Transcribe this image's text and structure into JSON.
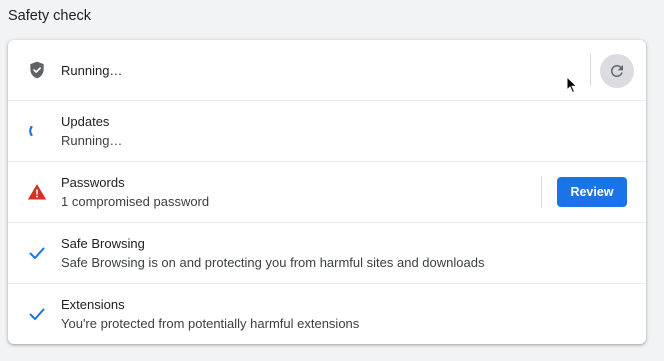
{
  "section": {
    "title": "Safety check"
  },
  "header_row": {
    "status": "Running…",
    "refresh_icon": "refresh-icon",
    "shield_icon": "shield-icon"
  },
  "rows": [
    {
      "title": "Updates",
      "subtitle": "Running…",
      "icon": "spinner-icon"
    },
    {
      "title": "Passwords",
      "subtitle": "1 compromised password",
      "icon": "warning-icon",
      "action_label": "Review"
    },
    {
      "title": "Safe Browsing",
      "subtitle": "Safe Browsing is on and protecting you from harmful sites and downloads",
      "icon": "checkmark-icon"
    },
    {
      "title": "Extensions",
      "subtitle": "You're protected from potentially harmful extensions",
      "icon": "checkmark-icon"
    }
  ],
  "colors": {
    "accent": "#1a73e8",
    "warning": "#d93025",
    "text": "#202124",
    "icon_gray": "#5f6368"
  }
}
